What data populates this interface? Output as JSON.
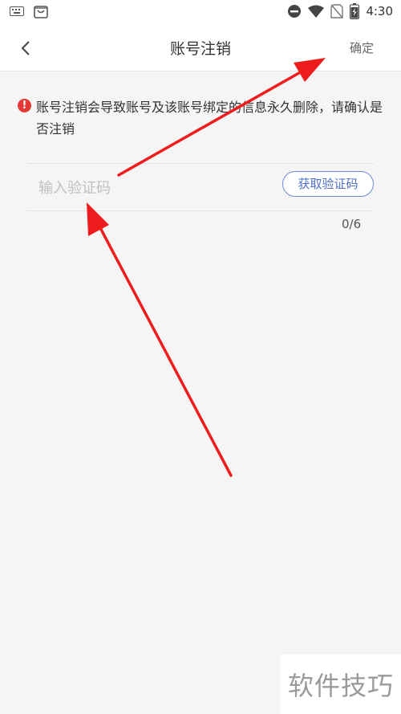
{
  "status_bar": {
    "time": "4:30",
    "battery_level": "0.6",
    "icons": [
      "keyboard-icon",
      "shop-bag-icon",
      "do-not-disturb-icon",
      "wifi-icon",
      "no-sim-icon",
      "battery-icon"
    ]
  },
  "header": {
    "title": "账号注销",
    "confirm_label": "确定"
  },
  "warning": {
    "text": "账号注销会导致账号及该账号绑定的信息永久删除，请确认是否注销",
    "icon": "!"
  },
  "code_field": {
    "placeholder": "输入验证码",
    "value": "",
    "get_code_label": "获取验证码",
    "counter": "0/6"
  },
  "watermark": {
    "text": "软件技巧"
  },
  "colors": {
    "accent": "#4f6fc8",
    "warning": "#e53935",
    "annotation": "#ee1c1c"
  }
}
